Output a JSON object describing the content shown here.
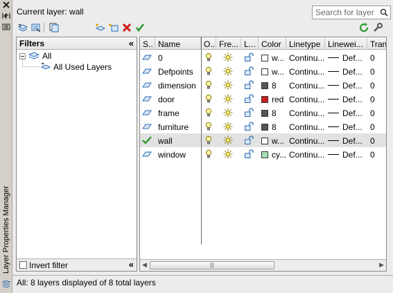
{
  "palette_title": "Layer Properties Manager",
  "current_layer_label": "Current layer: wall",
  "search": {
    "placeholder": "Search for layer"
  },
  "filters": {
    "header": "Filters",
    "tree": [
      {
        "label": "All"
      },
      {
        "label": "All Used Layers"
      }
    ],
    "invert_filter_label": "Invert filter",
    "invert_filter_checked": false
  },
  "columns": [
    "S..",
    "Name",
    "O..",
    "Fre...",
    "L...",
    "Color",
    "Linetype",
    "Linewei...",
    "Tran..."
  ],
  "layers": [
    {
      "name": "0",
      "color_name": "w...",
      "color_hex": "#ffffff",
      "linetype": "Continu...",
      "lineweight": "Def...",
      "transparency": "0",
      "current": false
    },
    {
      "name": "Defpoints",
      "color_name": "w...",
      "color_hex": "#ffffff",
      "linetype": "Continu...",
      "lineweight": "Def...",
      "transparency": "0",
      "current": false
    },
    {
      "name": "dimension",
      "color_name": "8",
      "color_hex": "#555555",
      "linetype": "Continu...",
      "lineweight": "Def...",
      "transparency": "0",
      "current": false
    },
    {
      "name": "door",
      "color_name": "red",
      "color_hex": "#c81e1e",
      "linetype": "Continu...",
      "lineweight": "Def...",
      "transparency": "0",
      "current": false
    },
    {
      "name": "frame",
      "color_name": "8",
      "color_hex": "#555555",
      "linetype": "Continu...",
      "lineweight": "Def...",
      "transparency": "0",
      "current": false
    },
    {
      "name": "furniture",
      "color_name": "8",
      "color_hex": "#555555",
      "linetype": "Continu...",
      "lineweight": "Def...",
      "transparency": "0",
      "current": false
    },
    {
      "name": "wall",
      "color_name": "w...",
      "color_hex": "#ffffff",
      "linetype": "Continu...",
      "lineweight": "Def...",
      "transparency": "0",
      "current": true
    },
    {
      "name": "window",
      "color_name": "cy...",
      "color_hex": "#a6e0b6",
      "linetype": "Continu...",
      "lineweight": "Def...",
      "transparency": "0",
      "current": false
    }
  ],
  "status": "All: 8 layers displayed of 8 total layers",
  "colors": {
    "accent_green": "#2e9a2e",
    "delete_red": "#d01818",
    "layer_icon_blue": "#2a6db5",
    "bulb_yellow": "#e2c400"
  },
  "icons": [
    "close-icon",
    "auto-hide-icon",
    "properties-icon",
    "new-property-filter-icon",
    "new-group-filter-icon",
    "layer-states-icon",
    "new-layer-icon",
    "new-vp-frozen-layer-icon",
    "delete-layer-icon",
    "set-current-icon",
    "refresh-icon",
    "settings-icon",
    "search-icon"
  ]
}
